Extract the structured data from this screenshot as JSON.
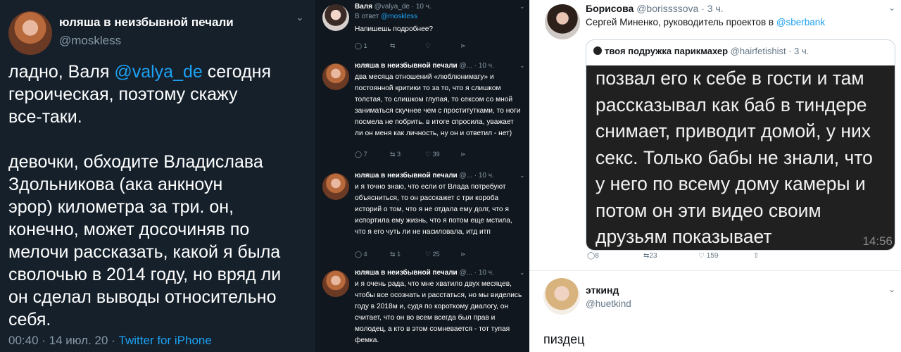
{
  "panel1": {
    "author_name": "юляша в неизбывной печали",
    "author_handle": "@moskless",
    "text_before_mention": "ладно, Валя ",
    "mention": "@valya_de",
    "text_after_mention": " сегодня\nгероическая, поэтому скажу\nвсе-таки.\n\nдевочки, обходите Владислава\nЗдольникова (ака анкноун\nэрор) километра за три. он,\nконечно, может досочиняв по\nмелочи рассказать, какой я была\nсволочью в 2014 году, но вряд ли\nон сделал выводы относительно\nсебя.",
    "timestamp": "00:40 · 14 июл. 20 · ",
    "source": "Twitter for iPhone"
  },
  "panel2": {
    "tweets": [
      {
        "author": "Валя",
        "handle_time": " @valya_de · 10 ч.",
        "reply_prefix": "В ответ ",
        "reply_to": "@moskless",
        "text": "Напишешь подробнее?",
        "replies": "1",
        "retweets": "",
        "likes": ""
      },
      {
        "author": "юляша в неизбывной печали",
        "handle_time": " @... · 10 ч.",
        "text": "два месяца отношений «люблюнимагу» и постоянной критики то за то, что я слишком толстая, то слишком глупая, то сексом со мной заниматься скучнее чем с проститутками, то ноги посмела не побрить. в итоге спросила, уважает ли он меня как личность, ну он и ответил - нет)",
        "replies": "7",
        "retweets": "3",
        "likes": "39"
      },
      {
        "author": "юляша в неизбывной печали",
        "handle_time": " @... · 10 ч.",
        "text": "и я точно знаю, что если от Влада потребуют объясниться, то он расскажет с три короба историй о том, что я не отдала ему долг, что я испортила ему жизнь, что я потом еще мстила, что я его чуть ли не насиловала, итд итп",
        "replies": "4",
        "retweets": "1",
        "likes": "25"
      },
      {
        "author": "юляша в неизбывной печали",
        "handle_time": " @... · 10 ч.",
        "text": "и я очень рада, что мне хватило двух месяцев, чтобы все осознать и расстаться, но мы виделись году в 2018м и, судя по короткому диалогу, он считает, что он во всем всегда был прав и молодец, а кто в этом сомневается - тот тупая фемка."
      }
    ]
  },
  "panel3": {
    "author_name": "Борисова",
    "author_handle_time": " @borissssova · 3 ч.",
    "text_prefix": "Сергей Миненко, руководитель проектов в ",
    "text_mention": "@sberbank",
    "quote_author": "твоя подружка парикмахер",
    "quote_handle_time": " @hairfetishist · 3 ч.",
    "quote_photo_text": "позвал его к себе в гости и там\nрассказывал как баб в тиндере\nснимает, приводит домой, у них\nсекс. Только бабы не знали, что\nу него по всему дому камеры и\nпотом он эти видео своим\nдрузьям показывает",
    "quote_photo_time": "14:56",
    "replies": "8",
    "retweets": "23",
    "likes": "159",
    "reply_name": "эткинд",
    "reply_handle": "@huetkind",
    "reply_text": "пиздец"
  },
  "icons": [
    "reply-icon",
    "retweet-icon",
    "like-icon",
    "share-icon",
    "chevron-down-icon"
  ],
  "colors": {
    "link": "#1da1f2",
    "dark_bg": "#15202b",
    "darker_bg": "#10171e",
    "muted": "#8899a6"
  }
}
